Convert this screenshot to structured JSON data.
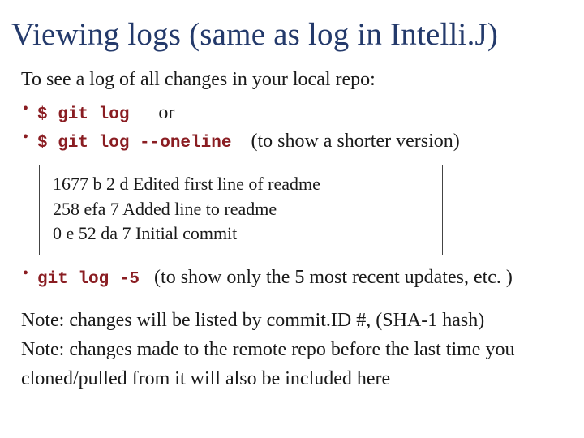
{
  "title": "Viewing logs (same as log in Intelli.J)",
  "intro": "To see a log of all changes in your local repo:",
  "bullets_top": {
    "item1": {
      "code": "$ git log",
      "suffix": "or"
    },
    "item2": {
      "code": "$ git log --oneline",
      "suffix": "(to show a shorter version)"
    }
  },
  "output": {
    "line1": "1677 b 2 d Edited first line of readme",
    "line2": "258 efa 7 Added line to readme",
    "line3": "0 e 52 da 7 Initial commit"
  },
  "bullets_bottom": {
    "item1": {
      "code": "git log -5",
      "suffix": "(to show only the 5 most recent updates, etc. )"
    }
  },
  "notes": {
    "n1": "Note: changes will be listed by commit.ID #, (SHA-1 hash)",
    "n2": "Note: changes made to the remote repo before the last time you cloned/pulled from it will also be included here"
  }
}
